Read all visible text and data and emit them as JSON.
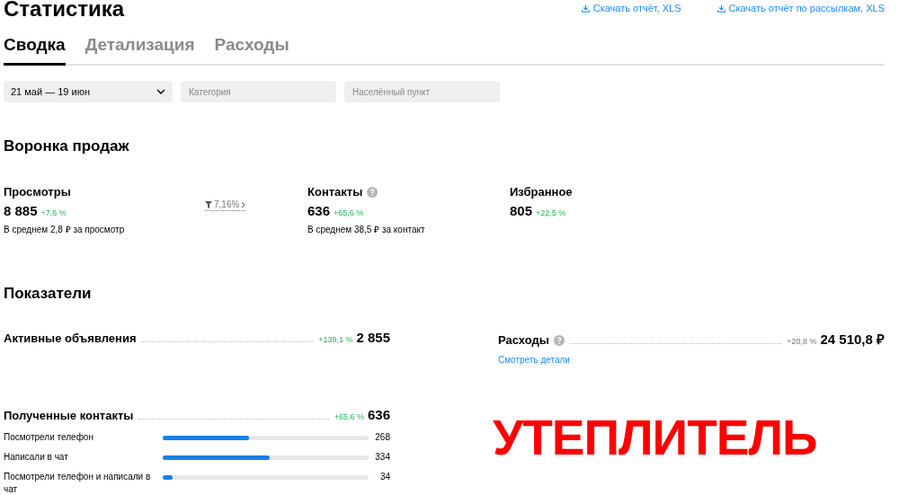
{
  "title": "Статистика",
  "downloads": [
    "Скачать отчёт, XLS",
    "Скачать отчёт по рассылкам, XLS"
  ],
  "tabs": [
    {
      "label": "Сводка",
      "selected": true
    },
    {
      "label": "Детализация",
      "selected": false
    },
    {
      "label": "Расходы",
      "selected": false
    }
  ],
  "filters": {
    "period": "21 май — 19 июн",
    "category": {
      "placeholder": "Категория"
    },
    "city": {
      "placeholder": "Населённый пункт"
    }
  },
  "funnel": {
    "title": "Воронка продаж",
    "conversion": "7,16%",
    "items": [
      {
        "label": "Просмотры",
        "help": false,
        "value": "8 885",
        "change": "+7,6 %",
        "note": "В среднем 2,8 ₽ за просмотр"
      },
      {
        "label": "Контакты",
        "help": true,
        "value": "636",
        "change": "+65,6 %",
        "note": "В среднем 38,5 ₽ за контакт"
      },
      {
        "label": "Избранное",
        "help": false,
        "value": "805",
        "change": "+22,5 %"
      }
    ]
  },
  "indicators": {
    "title": "Показатели",
    "active": {
      "label": "Активные объявления",
      "change": "+139,1 %",
      "value": "2 855"
    },
    "expenses": {
      "label": "Расходы",
      "change": "+20,8 %",
      "value": "24 510,8 ₽",
      "link": "Смотреть детали"
    },
    "contacts": {
      "label": "Полученные контакты",
      "change": "+65,6 %",
      "value": "636",
      "rows": [
        {
          "label": "Посмотрели телефон",
          "level": 0.42,
          "value": "268"
        },
        {
          "label": "Написали в чат",
          "level": 0.52,
          "value": "334"
        },
        {
          "label": "Посмотрели телефон и написали в чат",
          "level": 0.05,
          "value": "34"
        }
      ]
    }
  },
  "overlay_label": "УТЕПЛИТЕЛЬ"
}
